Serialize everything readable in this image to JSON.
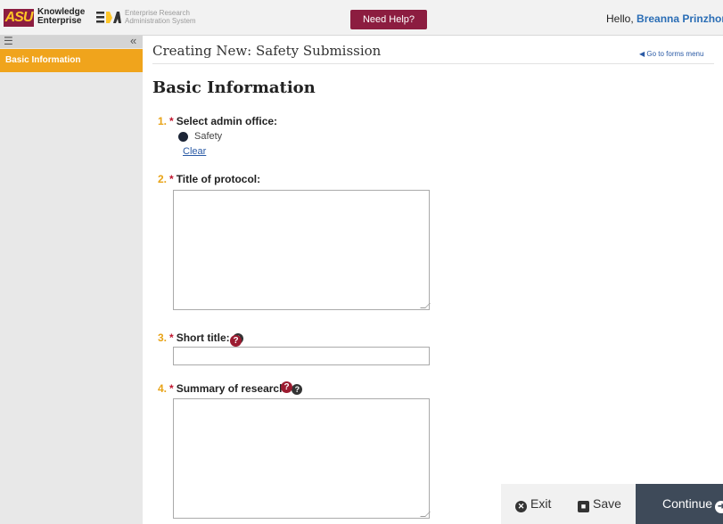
{
  "header": {
    "logo_asu": "ASU",
    "logo_ke_line1": "Knowledge",
    "logo_ke_line2": "Enterprise",
    "logo_era_line1": "Enterprise Research",
    "logo_era_line2": "Administration System",
    "help_button": "Need Help?",
    "greeting": "Hello,",
    "user_name": "Breanna Prinzhorn"
  },
  "sidebar": {
    "menu_icon": "hamburger-icon",
    "collapse_icon": "double-chevron-left-icon",
    "items": [
      {
        "label": "Basic Information",
        "active": true
      }
    ]
  },
  "main": {
    "page_title": "Creating New: Safety Submission",
    "forms_link": "Go to forms menu",
    "section_title": "Basic Information",
    "questions": [
      {
        "number": "1.",
        "label": "Select admin office:",
        "required": true
      },
      {
        "number": "2.",
        "label": "Title of protocol:",
        "required": true,
        "value": ""
      },
      {
        "number": "3.",
        "label": "Short title:",
        "required": true,
        "value": ""
      },
      {
        "number": "4.",
        "label": "Summary of research:",
        "required": true,
        "value": ""
      }
    ],
    "radio_option": "Safety",
    "clear_link": "Clear",
    "required_mark": "*"
  },
  "footer": {
    "exit": "Exit",
    "save": "Save",
    "continue": "Continue"
  },
  "colors": {
    "brand_maroon": "#8c1d40",
    "brand_gold": "#ffc627",
    "sidebar_active": "#f0a41c",
    "link_blue": "#2a5aa5",
    "continue_bg": "#3e4a59"
  }
}
